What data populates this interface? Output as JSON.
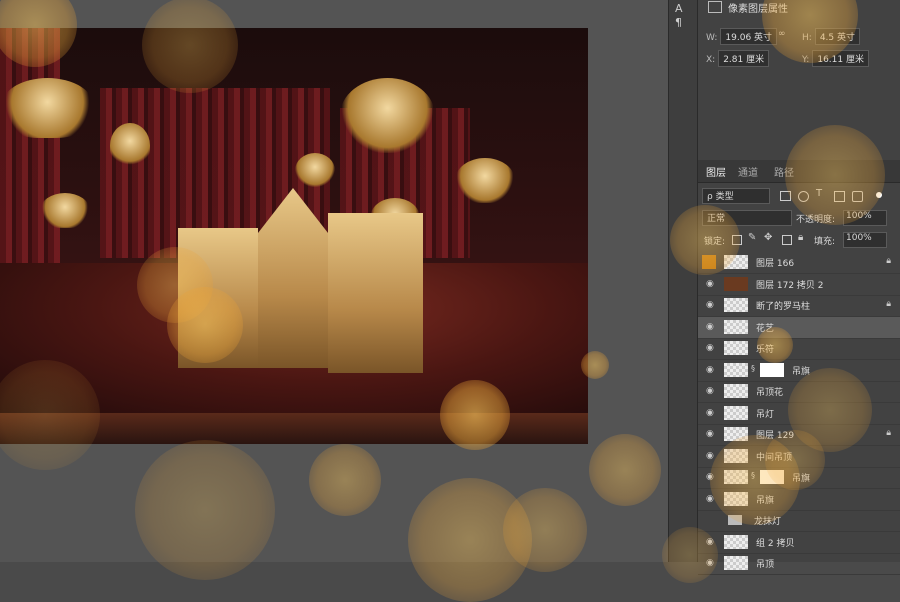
{
  "properties": {
    "title": "像素图层属性",
    "w_label": "W:",
    "w_value": "19.06 英寸",
    "link_icon": "link-icon",
    "h_label": "H:",
    "h_value": "4.5 英寸",
    "x_label": "X:",
    "x_value": "2.81 厘米",
    "y_label": "Y:",
    "y_value": "16.11 厘米"
  },
  "tabs": [
    "图层",
    "通道",
    "路径"
  ],
  "filter": {
    "label": "ρ 类型"
  },
  "blend": {
    "mode": "正常",
    "opacity_label": "不透明度:",
    "opacity_value": "100%"
  },
  "lock_row": {
    "label": "锁定:",
    "fill_label": "填充:",
    "fill_value": "100%"
  },
  "layers": [
    {
      "name": "图层 166",
      "locked": true
    },
    {
      "name": "图层 172 拷贝 2",
      "locked": false
    },
    {
      "name": "断了的罗马柱",
      "locked": true
    },
    {
      "name": "花艺",
      "locked": false
    },
    {
      "name": "乐符",
      "locked": false
    },
    {
      "name": "吊旗",
      "locked": false
    },
    {
      "name": "吊顶花",
      "locked": false
    },
    {
      "name": "吊灯",
      "locked": false
    },
    {
      "name": "图层 129",
      "locked": true
    },
    {
      "name": "中间吊顶",
      "locked": false
    },
    {
      "name": "吊旗",
      "locked": false
    },
    {
      "name": "吊旗",
      "locked": false
    },
    {
      "name": "龙抹灯",
      "locked": false
    },
    {
      "name": "组 2 拷贝",
      "locked": false
    },
    {
      "name": "吊顶",
      "locked": false
    }
  ]
}
